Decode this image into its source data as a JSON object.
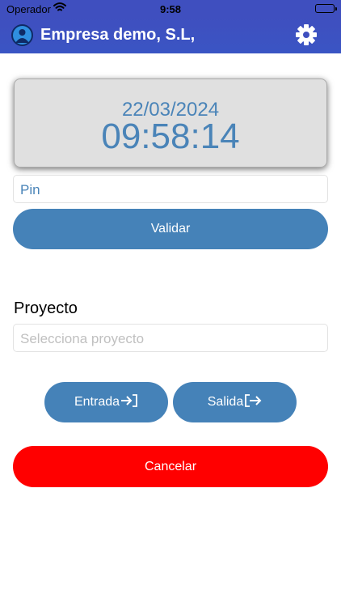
{
  "status_bar": {
    "carrier": "Operador",
    "time": "9:58"
  },
  "header": {
    "title": "Empresa demo, S.L,",
    "avatar_icon": "company-logo-icon",
    "settings_icon": "gear-icon",
    "color": "#3f4fbf"
  },
  "clock": {
    "date": "22/03/2024",
    "time": "09:58:14"
  },
  "pin": {
    "placeholder": "Pin"
  },
  "buttons": {
    "validar": "Validar",
    "entrada": "Entrada",
    "salida": "Salida",
    "cancelar": "Cancelar"
  },
  "project": {
    "label": "Proyecto",
    "placeholder": "Selecciona proyecto"
  },
  "colors": {
    "primary_button": "#4582b8",
    "cancel_button": "#ff0000"
  }
}
